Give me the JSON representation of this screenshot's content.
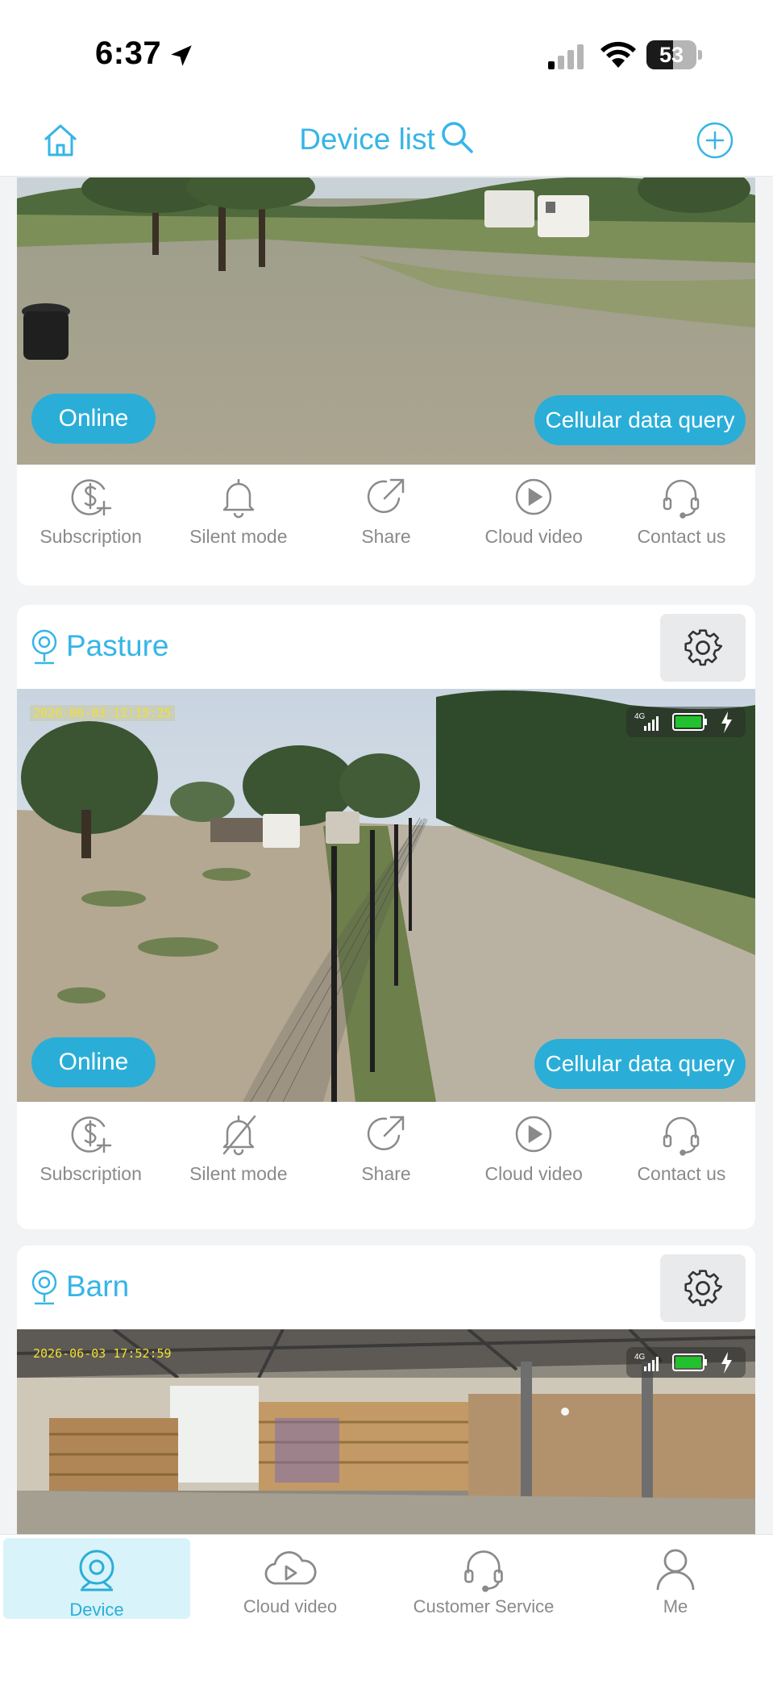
{
  "status_bar": {
    "time": "6:37",
    "battery": "53",
    "battery_level": 0.53,
    "icons": [
      "location-arrow-icon",
      "cellular-signal-icon",
      "wifi-icon",
      "battery-icon"
    ]
  },
  "header": {
    "title": "Device list",
    "icons": [
      "home-icon",
      "search-icon",
      "add-circle-icon"
    ]
  },
  "colors": {
    "accent": "#36b5e6",
    "pill": "#2aaed8",
    "label_gray": "#8a8a8a",
    "background": "#f2f3f5",
    "active_tab_bg": "#d9f3fa",
    "timestamp": "#f2e030",
    "battery_green": "#22c22e"
  },
  "actions": [
    {
      "label": "Subscription",
      "icon": "dollar-plus-icon"
    },
    {
      "label": "Silent mode",
      "icon": "bell-icon"
    },
    {
      "label": "Share",
      "icon": "share-icon"
    },
    {
      "label": "Cloud video",
      "icon": "play-circle-icon"
    },
    {
      "label": "Contact us",
      "icon": "headset-icon"
    }
  ],
  "cards": [
    {
      "name": "",
      "status": "Online",
      "data_button": "Cellular data query",
      "silent_icon": "bell-icon"
    },
    {
      "name": "Pasture",
      "timestamp": "2026-06-03 12:15:25",
      "status": "Online",
      "data_button": "Cellular data query",
      "network": "4G",
      "silent_icon": "bell-off-icon"
    },
    {
      "name": "Barn",
      "timestamp": "2026-06-03 17:52:59",
      "network": "4G"
    }
  ],
  "tabs": [
    {
      "label": "Device",
      "icon": "camera-icon",
      "active": true
    },
    {
      "label": "Cloud video",
      "icon": "cloud-play-icon",
      "active": false
    },
    {
      "label": "Customer Service",
      "icon": "headset-icon",
      "active": false
    },
    {
      "label": "Me",
      "icon": "person-icon",
      "active": false
    }
  ]
}
